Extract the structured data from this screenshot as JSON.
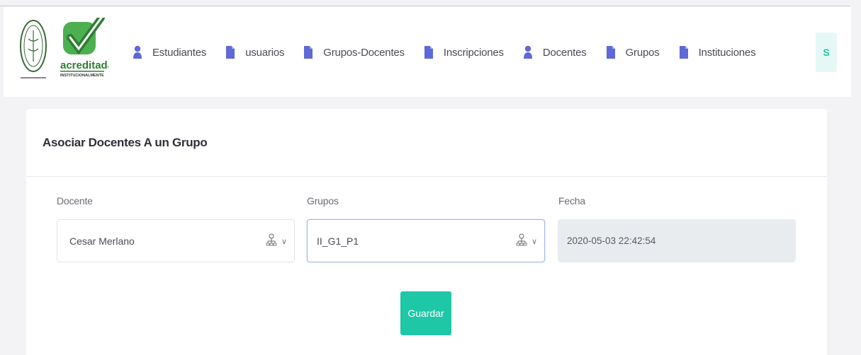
{
  "logos": {
    "seal_alt": "seal-logo",
    "acred_text": "acreditada",
    "acred_sub": "INSTITUCIONALMENTE"
  },
  "nav": {
    "items": [
      {
        "label": "Estudiantes",
        "icon": "person-icon"
      },
      {
        "label": "usuarios",
        "icon": "document-icon"
      },
      {
        "label": "Grupos-Docentes",
        "icon": "document-icon"
      },
      {
        "label": "Inscripciones",
        "icon": "document-icon"
      },
      {
        "label": "Docentes",
        "icon": "person-icon"
      },
      {
        "label": "Grupos",
        "icon": "document-icon"
      },
      {
        "label": "Instituciones",
        "icon": "document-icon"
      }
    ],
    "user_initial": "S",
    "accent": "#5e6ad2"
  },
  "form": {
    "title": "Asociar Docentes A un Grupo",
    "docente_label": "Docente",
    "docente_value": "Cesar Merlano",
    "grupos_label": "Grupos",
    "grupos_value": "II_G1_P1",
    "fecha_label": "Fecha",
    "fecha_value": "2020-05-03 22:42:54",
    "save_label": "Guardar"
  },
  "colors": {
    "primary": "#1ec8a6",
    "nav_icon": "#6068d8",
    "background": "#f3f3f6"
  }
}
